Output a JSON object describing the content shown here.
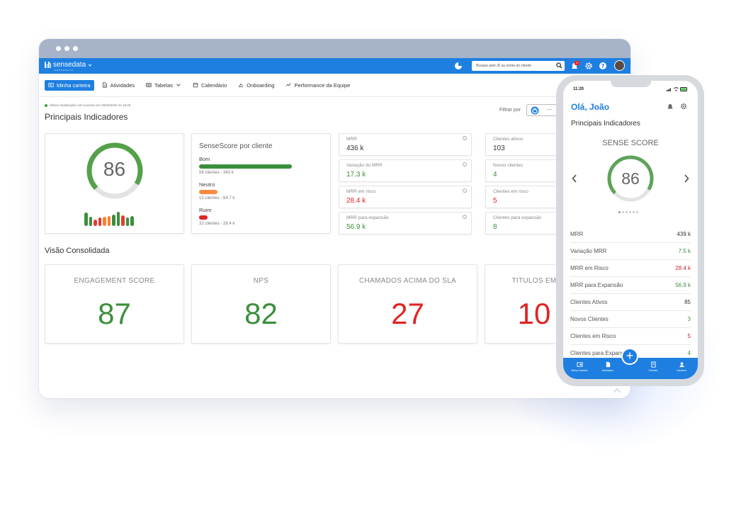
{
  "app": {
    "brand": "sensedata",
    "brand_sub": "SENSEDATA"
  },
  "appbar": {
    "search_placeholder": "Busque pelo ID ou nome do cliente",
    "notif_count": "9"
  },
  "nav": [
    {
      "label": "Minha carteira",
      "icon": "wallet-icon",
      "active": true
    },
    {
      "label": "Atividades",
      "icon": "document-icon"
    },
    {
      "label": "Tabelas",
      "icon": "table-icon",
      "dropdown": true
    },
    {
      "label": "Calendário",
      "icon": "calendar-icon"
    },
    {
      "label": "Onboarding",
      "icon": "onboarding-icon"
    },
    {
      "label": "Performance da Equipe",
      "icon": "trend-icon"
    }
  ],
  "updated_text": "Última Atualização com sucesso em 25/03/2022 às 16:29",
  "main_title": "Principais Indicadores",
  "filter_label": "Filtrar por",
  "filter_value": "—",
  "score_card": {
    "value": "86",
    "fraction": 0.86,
    "mini_bars": [
      {
        "h": 0.85,
        "c": "#3b8f3b"
      },
      {
        "h": 0.6,
        "c": "#3b8f3b"
      },
      {
        "h": 0.4,
        "c": "#e53935"
      },
      {
        "h": 0.55,
        "c": "#e53935"
      },
      {
        "h": 0.6,
        "c": "#ff7f32"
      },
      {
        "h": 0.65,
        "c": "#ff7f32"
      },
      {
        "h": 0.75,
        "c": "#3b8f3b"
      },
      {
        "h": 0.9,
        "c": "#3b8f3b"
      },
      {
        "h": 0.7,
        "c": "#e53935"
      },
      {
        "h": 0.55,
        "c": "#3b8f3b"
      },
      {
        "h": 0.65,
        "c": "#3b8f3b"
      }
    ]
  },
  "sensescore": {
    "title": "SenseScore por cliente",
    "rows": [
      {
        "label": "Bom",
        "sub": "58 clientes - 343 k",
        "fraction": 0.75,
        "color": "#3b8f3b"
      },
      {
        "label": "Neutro",
        "sub": "13 clientes - 64.7 k",
        "fraction": 0.15,
        "color": "#ff8a3d"
      },
      {
        "label": "Ruim",
        "sub": "32 clientes - 28.4 k",
        "fraction": 0.07,
        "color": "#e02424"
      }
    ]
  },
  "kpis_left": [
    {
      "label": "MRR",
      "value": "436 k",
      "color": "#333333"
    },
    {
      "label": "Variação do MRR",
      "value": "17.3 k",
      "color": "#3b8f3b"
    },
    {
      "label": "MRR em risco",
      "value": "28.4 k",
      "color": "#e02424"
    },
    {
      "label": "MRR para expansão",
      "value": "56.9 k",
      "color": "#3b8f3b"
    }
  ],
  "kpis_right": [
    {
      "label": "Clientes ativos",
      "value": "103",
      "color": "#333333"
    },
    {
      "label": "Novos clientes",
      "value": "4",
      "color": "#3b8f3b"
    },
    {
      "label": "Clientes em risco",
      "value": "5",
      "color": "#e02424"
    },
    {
      "label": "Clientes para expansão",
      "value": "8",
      "color": "#3b8f3b"
    }
  ],
  "consolidated_title": "Visão Consolidada",
  "big_cards": [
    {
      "label": "ENGAGEMENT SCORE",
      "value": "87",
      "color": "#3b8f3b"
    },
    {
      "label": "NPS",
      "value": "82",
      "color": "#3b8f3b"
    },
    {
      "label": "CHAMADOS ACIMA DO SLA",
      "value": "27",
      "color": "#e02424"
    },
    {
      "label": "TITULOS EM",
      "value": "10",
      "color": "#e02424"
    }
  ],
  "phone": {
    "time": "11:20",
    "greeting": "Olá,  João",
    "title": "Principais Indicadores",
    "sense_label": "SENSE SCORE",
    "score": "86",
    "score_fraction": 0.86,
    "rows": [
      {
        "label": "MRR",
        "value": "439 k",
        "color": "#333333"
      },
      {
        "label": "Variação MRR",
        "value": "7.5 k",
        "color": "#3b8f3b"
      },
      {
        "label": "MRR em Risco",
        "value": "28.4 k",
        "color": "#c62828"
      },
      {
        "label": "MRR para Expansão",
        "value": "56.9 k",
        "color": "#3b8f3b"
      },
      {
        "label": "Clientes Ativos",
        "value": "85",
        "color": "#333333"
      },
      {
        "label": "Novos Clientes",
        "value": "3",
        "color": "#3b8f3b"
      },
      {
        "label": "Clientes em Risco",
        "value": "5",
        "color": "#c62828"
      },
      {
        "label": "Clientes para Expansão",
        "value": "4",
        "color": "#3b8f3b"
      }
    ],
    "tabs": [
      {
        "label": "Minha Carteira",
        "icon": "wallet-icon"
      },
      {
        "label": "Atividades",
        "icon": "document-icon"
      },
      {
        "label": "Clientes",
        "icon": "building-icon"
      },
      {
        "label": "Usuários",
        "icon": "user-icon"
      }
    ]
  }
}
